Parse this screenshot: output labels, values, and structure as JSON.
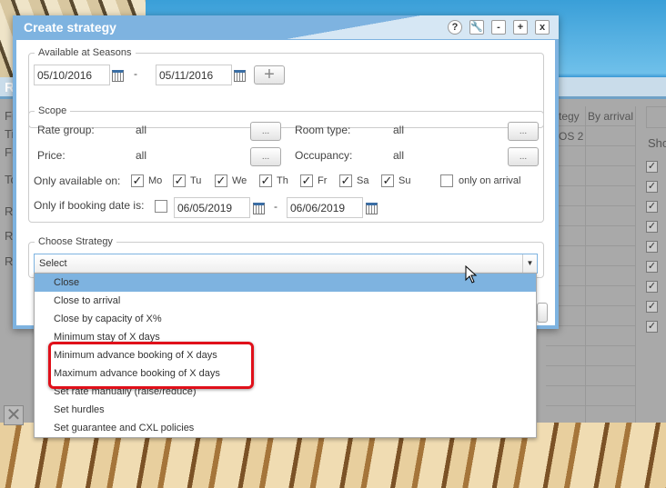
{
  "background": {
    "window_title_initial": "R",
    "left_labels": [
      "Fi",
      "Ti",
      "Fr",
      "To",
      "R",
      "R",
      "R"
    ],
    "table_headers": [
      "tegy",
      "By arrival"
    ],
    "table_cells": [
      "OS 2"
    ],
    "side_label": "Sho",
    "checkbox_count": 9
  },
  "dialog": {
    "title": "Create strategy",
    "buttons": [
      "?",
      "wrench",
      "-",
      "+",
      "x"
    ]
  },
  "seasons": {
    "legend": "Available at Seasons",
    "from": "05/10/2016",
    "separator": "-",
    "to": "05/11/2016",
    "add_label": "+"
  },
  "scope": {
    "legend": "Scope",
    "rate_group_label": "Rate group:",
    "rate_group_value": "all",
    "room_type_label": "Room type:",
    "room_type_value": "all",
    "price_label": "Price:",
    "price_value": "all",
    "occupancy_label": "Occupancy:",
    "occupancy_value": "all",
    "more_label": "...",
    "days_label": "Only available on:",
    "days": [
      {
        "label": "Mo",
        "checked": true
      },
      {
        "label": "Tu",
        "checked": true
      },
      {
        "label": "We",
        "checked": true
      },
      {
        "label": "Th",
        "checked": true
      },
      {
        "label": "Fr",
        "checked": true
      },
      {
        "label": "Sa",
        "checked": true
      },
      {
        "label": "Su",
        "checked": true
      }
    ],
    "only_on_arrival_label": "only on arrival",
    "only_on_arrival_checked": false,
    "booking_label": "Only if booking date is:",
    "booking_checked": false,
    "booking_from": "06/05/2019",
    "booking_separator": "-",
    "booking_to": "06/06/2019"
  },
  "strategy": {
    "legend": "Choose Strategy",
    "selected": "Select",
    "options": [
      "Close",
      "Close to arrival",
      "Close by capacity of X%",
      "Minimum stay of X days",
      "Minimum advance booking of X days",
      "Maximum advance booking of X days",
      "Set rate manually (raise/reduce)",
      "Set hurdles",
      "Set guarantee and CXL policies"
    ],
    "highlighted": "Close",
    "annotated_options": [
      "Minimum advance booking of X days",
      "Maximum advance booking of X days"
    ],
    "annotation_color": "#e0101a"
  },
  "colors": {
    "accent": "#7eb3e0"
  }
}
